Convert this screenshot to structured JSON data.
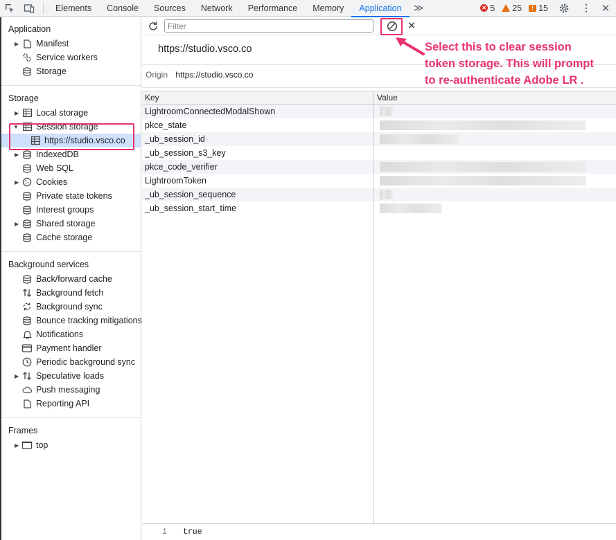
{
  "toolbar": {
    "tabs": [
      {
        "label": "Elements"
      },
      {
        "label": "Console"
      },
      {
        "label": "Sources"
      },
      {
        "label": "Network"
      },
      {
        "label": "Performance"
      },
      {
        "label": "Memory"
      },
      {
        "label": "Application"
      }
    ],
    "more_glyph": "≫",
    "errors": "5",
    "warnings": "25",
    "issues": "15",
    "accent_color": "#1a73e8"
  },
  "sidebar": {
    "application": {
      "title": "Application",
      "items": [
        {
          "label": "Manifest",
          "icon": "file-icon",
          "expandable": true
        },
        {
          "label": "Service workers",
          "icon": "gears-icon",
          "expandable": false
        },
        {
          "label": "Storage",
          "icon": "database-icon",
          "expandable": false
        }
      ]
    },
    "storage": {
      "title": "Storage",
      "items": [
        {
          "label": "Local storage",
          "icon": "table-icon",
          "expandable": true
        },
        {
          "label": "Session storage",
          "icon": "table-icon",
          "expandable": true,
          "expanded": true
        },
        {
          "label": "https://studio.vsco.co",
          "icon": "table-icon",
          "selected": true
        },
        {
          "label": "IndexedDB",
          "icon": "database-icon",
          "expandable": true
        },
        {
          "label": "Web SQL",
          "icon": "database-icon"
        },
        {
          "label": "Cookies",
          "icon": "cookie-icon",
          "expandable": true
        },
        {
          "label": "Private state tokens",
          "icon": "database-icon"
        },
        {
          "label": "Interest groups",
          "icon": "database-icon"
        },
        {
          "label": "Shared storage",
          "icon": "database-icon",
          "expandable": true
        },
        {
          "label": "Cache storage",
          "icon": "database-icon"
        }
      ]
    },
    "background": {
      "title": "Background services",
      "items": [
        {
          "label": "Back/forward cache",
          "icon": "database-icon"
        },
        {
          "label": "Background fetch",
          "icon": "arrows-updown-icon"
        },
        {
          "label": "Background sync",
          "icon": "sync-icon"
        },
        {
          "label": "Bounce tracking mitigations",
          "icon": "database-icon"
        },
        {
          "label": "Notifications",
          "icon": "bell-icon"
        },
        {
          "label": "Payment handler",
          "icon": "card-icon"
        },
        {
          "label": "Periodic background sync",
          "icon": "clock-icon"
        },
        {
          "label": "Speculative loads",
          "icon": "arrows-updown-icon",
          "expandable": true
        },
        {
          "label": "Push messaging",
          "icon": "cloud-icon"
        },
        {
          "label": "Reporting API",
          "icon": "file-icon"
        }
      ]
    },
    "frames": {
      "title": "Frames",
      "items": [
        {
          "label": "top",
          "icon": "frame-icon",
          "expandable": true
        }
      ]
    }
  },
  "main": {
    "filter_placeholder": "Filter",
    "origin_title": "https://studio.vsco.co",
    "origin_label": "Origin",
    "origin_value": "https://studio.vsco.co",
    "table": {
      "headers": [
        "Key",
        "Value"
      ],
      "rows": [
        {
          "key": "LightroomConnectedModalShown",
          "value_blur": 0.06
        },
        {
          "key": "pkce_state",
          "value_blur": 0.93
        },
        {
          "key": "_ub_session_id",
          "value_blur": 0.36
        },
        {
          "key": "_ub_session_s3_key",
          "value_blur": 0.0
        },
        {
          "key": "pkce_code_verifier",
          "value_blur": 0.93
        },
        {
          "key": "LightroomToken",
          "value_blur": 0.93
        },
        {
          "key": "_ub_session_sequence",
          "value_blur": 0.06
        },
        {
          "key": "_ub_session_start_time",
          "value_blur": 0.28
        }
      ]
    },
    "preview": {
      "line": "1",
      "value": "true"
    }
  },
  "annotation": {
    "text_line1": "Select this to clear session",
    "text_line2": "token storage. This will prompt",
    "text_line3": "to re-authenticate Adobe LR .",
    "color": "#e8336e"
  }
}
